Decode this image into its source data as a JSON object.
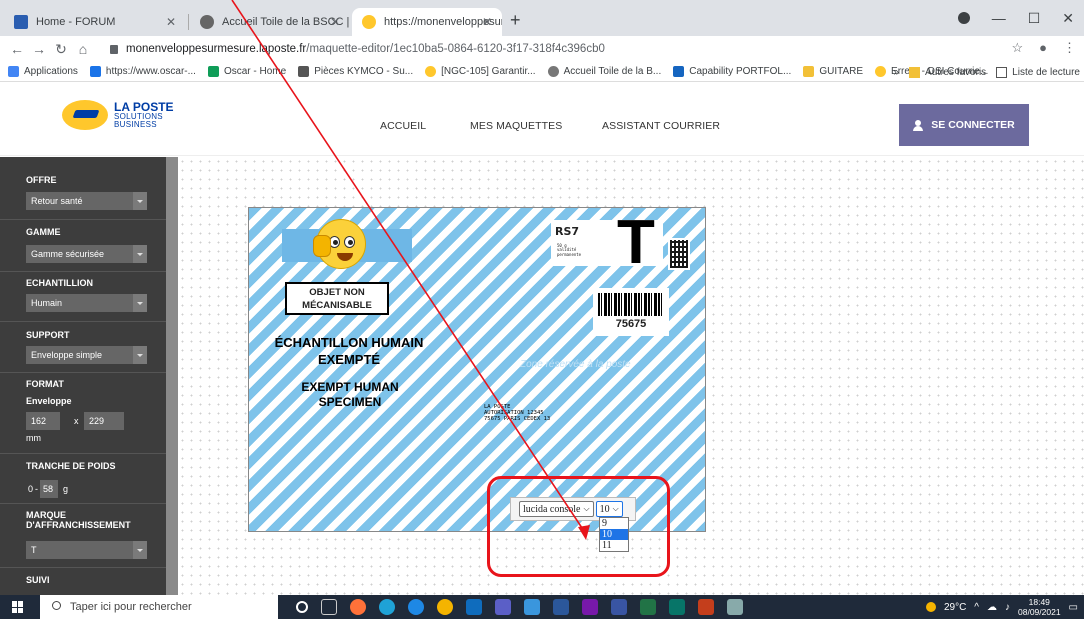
{
  "browser": {
    "tabs": [
      {
        "label": "Home - FORUM",
        "active": false
      },
      {
        "label": "Accueil Toile de la BSCC | La Toile",
        "active": false
      },
      {
        "label": "https://monenveloppesurmesure",
        "active": true
      }
    ],
    "url_host": "monenveloppesurmesure.laposte.fr",
    "url_path": "/maquette-editor/1ec10ba5-0864-6120-3f17-318f4c396cb0",
    "bookmarks": [
      "Applications",
      "https://www.oscar-...",
      "Oscar - Home",
      "Pièces KYMCO - Su...",
      "[NGC-105] Garantir...",
      "Accueil Toile de la B...",
      "Capability PORTFOL...",
      "GUITARE",
      "Erreur - DSI Courrie..."
    ],
    "bookmarks_more": "»",
    "other_bookmarks": "Autres favoris",
    "reading_list": "Liste de lecture"
  },
  "site": {
    "logo_line1": "LA POSTE",
    "logo_line2": "SOLUTIONS",
    "logo_line3": "BUSINESS",
    "nav": [
      "ACCUEIL",
      "MES MAQUETTES",
      "ASSISTANT COURRIER"
    ],
    "connect_label": "SE CONNECTER"
  },
  "sidebar": {
    "offre_label": "OFFRE",
    "offre_value": "Retour santé",
    "gamme_label": "GAMME",
    "gamme_value": "Gamme sécurisée",
    "echantillon_label": "ECHANTILLION",
    "echantillon_value": "Humain",
    "support_label": "SUPPORT",
    "support_value": "Enveloppe simple",
    "format_label": "FORMAT",
    "format_sub": "Enveloppe",
    "width": "162",
    "times": "x",
    "height": "229",
    "unit": "mm",
    "tranche_label": "TRANCHE DE POIDS",
    "poids_min": "0",
    "poids_sep": "-",
    "poids_max": "58",
    "poids_unit": "g",
    "marque_label_1": "MARQUE",
    "marque_label_2": "D'AFFRANCHISSEMENT",
    "marque_value": "T",
    "suivi_label": "SUIVI"
  },
  "envelope": {
    "rs7": "RS7",
    "rs7_small": [
      "50 g",
      "validité",
      "permanente"
    ],
    "big_t": "T",
    "objet_line1": "OBJET NON",
    "objet_line2": "MÉCANISABLE",
    "barcode_number": "75675",
    "specimen_fr_1": "ÉCHANTILLON HUMAIN",
    "specimen_fr_2": "EXEMPTÉ",
    "specimen_en_1": "EXEMPT HUMAN",
    "specimen_en_2": "SPECIMEN",
    "zone_note": "Zone réservée à la poste",
    "address": [
      "LA POSTE",
      "AUTORISATION 12345",
      "75675 PARIS CEDEX 13"
    ]
  },
  "font_toolbar": {
    "font_value": "lucida console",
    "size_value": "10",
    "size_options": [
      "9",
      "10",
      "11"
    ],
    "selected_size": "10"
  },
  "taskbar": {
    "search_placeholder": "Taper ici pour rechercher",
    "temperature": "29°C",
    "time": "18:49",
    "date": "08/09/2021"
  },
  "colors": {
    "envelope_stripe": "#7ec3ea",
    "sidebar_bg": "#3d3d3d",
    "connect_button": "#6c6a9e",
    "annotation_red": "#e8141b",
    "selected_option": "#1e74e6"
  }
}
